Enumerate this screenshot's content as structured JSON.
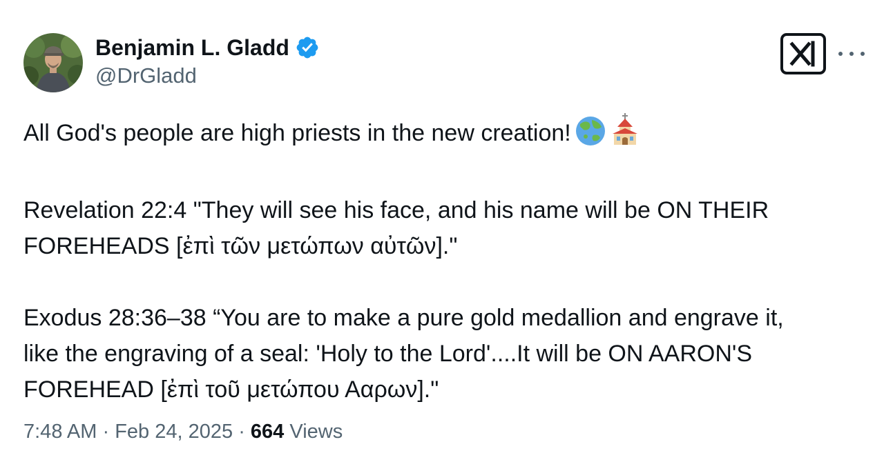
{
  "author": {
    "display_name": "Benjamin L. Gladd",
    "handle": "@DrGladd",
    "verified": true,
    "avatar_icon": "profile-photo"
  },
  "actions": {
    "grok_icon": "grok-icon",
    "more_icon": "more-options-icon"
  },
  "tweet": {
    "line1": "All God's people are high priests in the new creation!",
    "line1_emojis": [
      "globe-asia-australia-emoji",
      "church-emoji"
    ],
    "para2": [
      "Revelation 22:4 \"They will see his face, and his name will be ON THEIR",
      "FOREHEADS [ἐπὶ τῶν μετώπων αὐτῶν].\""
    ],
    "para3": [
      "Exodus 28:36–38 “You are to make a pure gold medallion and engrave it,",
      "like the engraving of a seal: 'Holy to the Lord'....It will be ON AARON'S",
      "FOREHEAD [ἐπὶ τοῦ μετώπου Ααρων].\""
    ]
  },
  "meta": {
    "time": "7:48 AM",
    "separator": "·",
    "date": "Feb 24, 2025",
    "views_count": "664",
    "views_label": "Views"
  },
  "colors": {
    "text": "#0f1419",
    "secondary": "#536471",
    "verified_blue": "#1d9bf0"
  }
}
